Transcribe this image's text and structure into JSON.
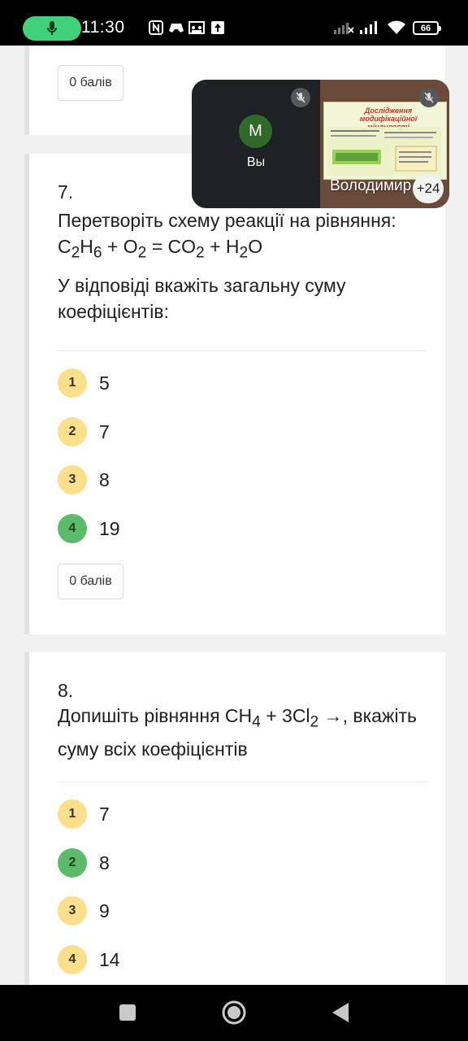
{
  "status_bar": {
    "time": "11:30",
    "battery": "66",
    "icons": [
      "mic-icon",
      "nfc-icon",
      "game-icon",
      "meet-icon",
      "upload-icon",
      "signal-off-icon",
      "signal-icon",
      "wifi-icon",
      "battery-icon"
    ],
    "mic_pill_color": "#3fd27a"
  },
  "cards": [
    {
      "score_label": "0 балів"
    },
    {
      "number": "7.",
      "question_line1": "Перетворіть схему реакції на рівняння:",
      "equation": {
        "c": "C",
        "c_sub": "2",
        "h": "H",
        "h_sub": "6",
        "o2": " + O",
        "o2_sub": "2",
        "eq": " = CO",
        "co2_sub": "2",
        "h2o": " + H",
        "h2o_sub": "2",
        "o": "O"
      },
      "instruction": "У відповіді вкажіть загальну суму коефіцієнтів:",
      "options": [
        {
          "num": "1",
          "text": "5",
          "correct": false
        },
        {
          "num": "2",
          "text": "7",
          "correct": false
        },
        {
          "num": "3",
          "text": "8",
          "correct": false
        },
        {
          "num": "4",
          "text": "19",
          "correct": true
        }
      ],
      "score_label": "0 балів"
    },
    {
      "number": "8.",
      "question": {
        "pre": "Допишіть рівняння CH",
        "sub1": "4",
        "mid": " + 3Cl",
        "sub2": "2",
        "post": " →, вкажіть суму всіх коефіцієнтів"
      },
      "options": [
        {
          "num": "1",
          "text": "7",
          "correct": false
        },
        {
          "num": "2",
          "text": "8",
          "correct": true
        },
        {
          "num": "3",
          "text": "9",
          "correct": false
        },
        {
          "num": "4",
          "text": "14",
          "correct": false
        }
      ]
    }
  ],
  "meet": {
    "self_initial": "M",
    "self_name": "Вы",
    "slide_title": "Дослідження модифікаційної мінливості",
    "remote_name": "Володимир",
    "more_participants": "+24"
  },
  "nav": {
    "buttons": [
      "recents-square-icon",
      "home-circle-icon",
      "back-triangle-icon"
    ]
  },
  "colors": {
    "badge_default": "#fbdf8a",
    "badge_correct": "#5cba6b",
    "avatar": "#2e6b2a"
  }
}
